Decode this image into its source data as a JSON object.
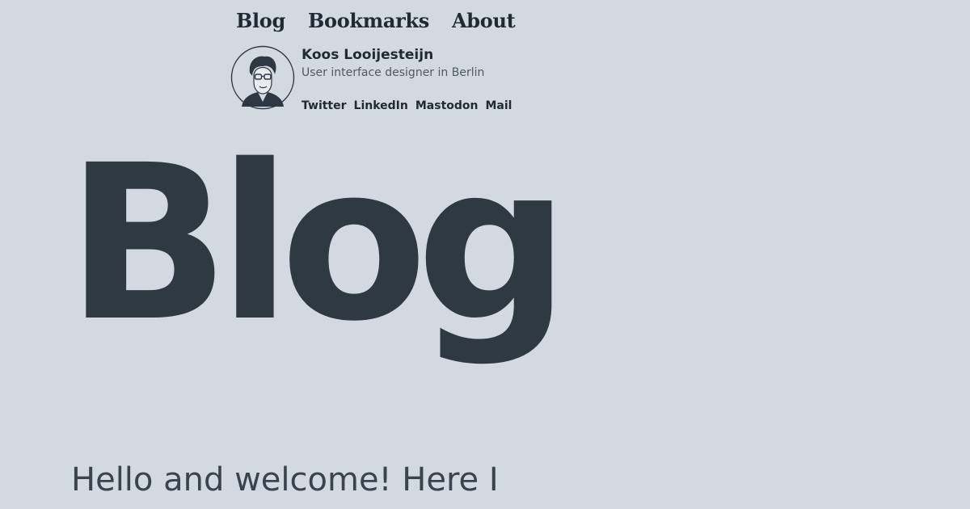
{
  "nav": {
    "items": [
      {
        "label": "Blog"
      },
      {
        "label": "Bookmarks"
      },
      {
        "label": "About"
      }
    ]
  },
  "profile": {
    "name": "Koos Looijesteijn",
    "tagline": "User interface designer in Berlin",
    "links": [
      {
        "label": "Twitter"
      },
      {
        "label": "LinkedIn"
      },
      {
        "label": "Mastodon"
      },
      {
        "label": "Mail"
      }
    ]
  },
  "hero": {
    "title": "Blog"
  },
  "intro": {
    "text": "Hello and welcome! Here I"
  },
  "colors": {
    "background": "#d3d9e0",
    "text": "#2e3842"
  }
}
